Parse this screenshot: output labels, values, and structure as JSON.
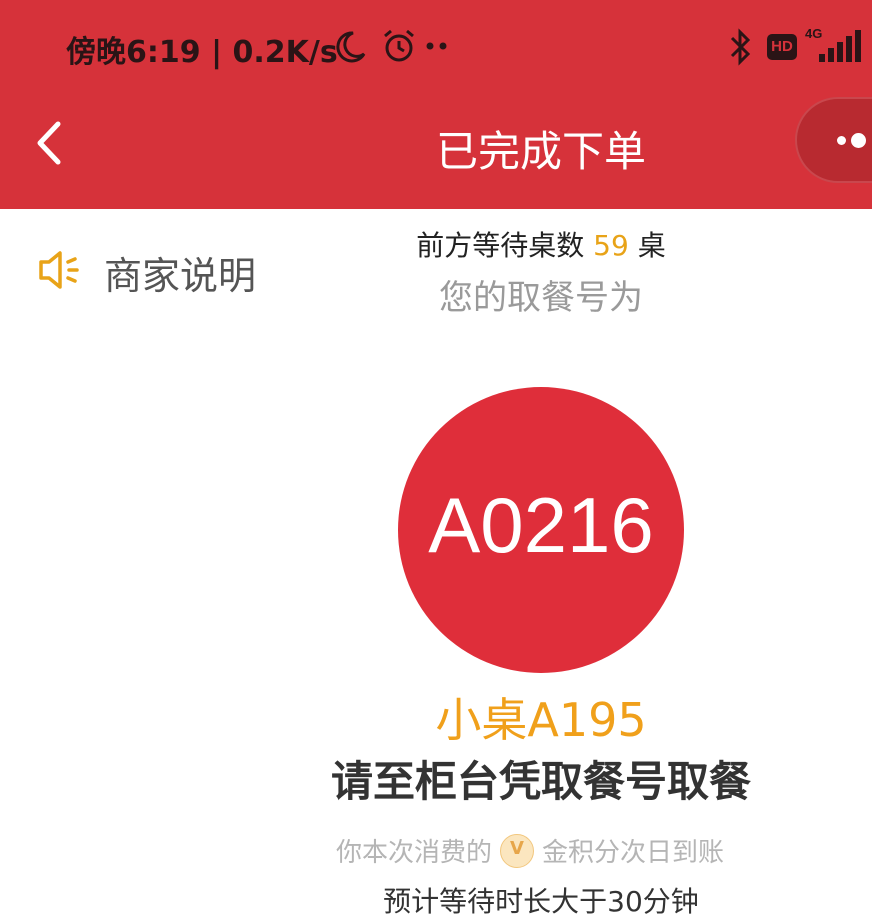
{
  "status_bar": {
    "text": "傍晚6:19 | 0.2K/s",
    "icons": [
      "moon-icon",
      "alarm-icon",
      "more-dots-icon",
      "bluetooth-icon",
      "hd-icon",
      "4g-signal-icon"
    ],
    "hd_label": "HD",
    "network_label": "4G"
  },
  "nav": {
    "title": "已完成下单",
    "back_icon": "chevron-left-icon",
    "menu_icon": "more-dots-icon"
  },
  "merchant": {
    "icon": "speaker-icon",
    "label": "商家说明"
  },
  "queue": {
    "prefix": "前方等待桌数",
    "count": "59",
    "suffix": "桌"
  },
  "your_number_label": "您的取餐号为",
  "ticket": {
    "number": "A0216",
    "table": "小桌A195",
    "instruction": "请至柜台凭取餐号取餐"
  },
  "points": {
    "prefix": "你本次消费的",
    "coin_letter": "V",
    "suffix": "金积分次日到账"
  },
  "wait_note": "预计等待时长大于30分钟",
  "colors": {
    "brand_red": "#d6323a",
    "ticket_red": "#df2e3a",
    "accent_orange": "#f0a01b"
  }
}
